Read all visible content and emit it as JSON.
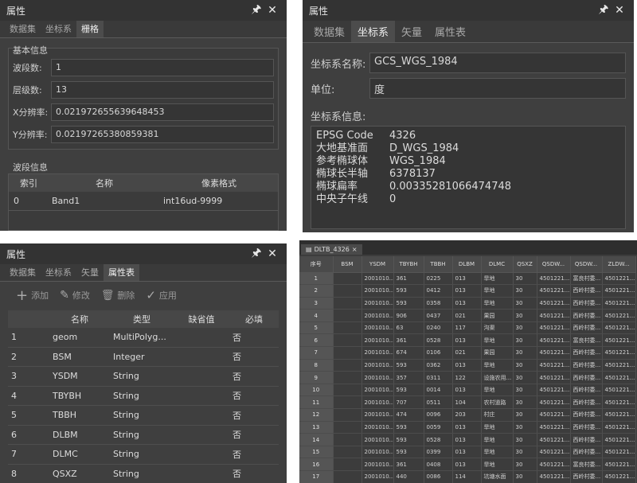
{
  "p1": {
    "title": "属性",
    "tabs": [
      "数据集",
      "坐标系",
      "栅格"
    ],
    "active_tab": 2,
    "basic_section": "基本信息",
    "fields": [
      {
        "label": "波段数:",
        "value": "1"
      },
      {
        "label": "层级数:",
        "value": "13"
      },
      {
        "label": "X分辨率:",
        "value": "0.021972655639648453"
      },
      {
        "label": "Y分辨率:",
        "value": "0.02197265380859381"
      }
    ],
    "band_section": "波段信息",
    "band_headers": [
      "索引",
      "名称",
      "像素格式"
    ],
    "band_rows": [
      [
        "0",
        "Band1",
        "int16ud-9999"
      ]
    ]
  },
  "p2": {
    "title": "属性",
    "tabs": [
      "数据集",
      "坐标系",
      "矢量",
      "属性表"
    ],
    "active_tab": 1,
    "name_label": "坐标系名称:",
    "name_value": "GCS_WGS_1984",
    "unit_label": "单位:",
    "unit_value": "度",
    "info_label": "坐标系信息:",
    "info": [
      {
        "k": "EPSG Code",
        "v": "4326"
      },
      {
        "k": "大地基准面",
        "v": "D_WGS_1984"
      },
      {
        "k": "参考椭球体",
        "v": "WGS_1984"
      },
      {
        "k": "椭球长半轴",
        "v": "6378137"
      },
      {
        "k": "椭球扁率",
        "v": "0.00335281066474748"
      },
      {
        "k": "中央子午线",
        "v": "0"
      }
    ]
  },
  "p3": {
    "title": "属性",
    "tabs": [
      "数据集",
      "坐标系",
      "矢量",
      "属性表"
    ],
    "active_tab": 3,
    "toolbar": {
      "add": "添加",
      "edit": "修改",
      "delete": "删除",
      "apply": "应用"
    },
    "headers": [
      "名称",
      "类型",
      "缺省值",
      "必填"
    ],
    "rows": [
      [
        "1",
        "geom",
        "MultiPolyg...",
        "",
        "否"
      ],
      [
        "2",
        "BSM",
        "Integer",
        "",
        "否"
      ],
      [
        "3",
        "YSDM",
        "String",
        "",
        "否"
      ],
      [
        "4",
        "TBYBH",
        "String",
        "",
        "否"
      ],
      [
        "5",
        "TBBH",
        "String",
        "",
        "否"
      ],
      [
        "6",
        "DLBM",
        "String",
        "",
        "否"
      ],
      [
        "7",
        "DLMC",
        "String",
        "",
        "否"
      ],
      [
        "8",
        "QSXZ",
        "String",
        "",
        "否"
      ]
    ]
  },
  "p4": {
    "tab": "DLTB_4326",
    "headers": [
      "序号",
      "BSM",
      "YSDM",
      "TBYBH",
      "TBBH",
      "DLBM",
      "DLMC",
      "QSXZ",
      "QSDW...",
      "QSDW...",
      "ZLDW..."
    ],
    "rows": [
      [
        "1",
        "",
        "2001010...",
        "361",
        "0225",
        "013",
        "旱地",
        "30",
        "4501221...",
        "富良村委...",
        "4501221..."
      ],
      [
        "2",
        "",
        "2001010...",
        "593",
        "0412",
        "013",
        "旱地",
        "30",
        "4501221...",
        "西岭村委...",
        "4501221..."
      ],
      [
        "3",
        "",
        "2001010...",
        "593",
        "0358",
        "013",
        "旱地",
        "30",
        "4501221...",
        "西岭村委...",
        "4501221..."
      ],
      [
        "4",
        "",
        "2001010...",
        "906",
        "0437",
        "021",
        "果园",
        "30",
        "4501221...",
        "西岭村委...",
        "4501221..."
      ],
      [
        "5",
        "",
        "2001010...",
        "63",
        "0240",
        "117",
        "沟渠",
        "30",
        "4501221...",
        "西岭村委...",
        "4501221..."
      ],
      [
        "6",
        "",
        "2001010...",
        "361",
        "0528",
        "013",
        "旱地",
        "30",
        "4501221...",
        "富良村委...",
        "4501221..."
      ],
      [
        "7",
        "",
        "2001010...",
        "674",
        "0106",
        "021",
        "果园",
        "30",
        "4501221...",
        "西岭村委...",
        "4501221..."
      ],
      [
        "8",
        "",
        "2001010...",
        "593",
        "0362",
        "013",
        "旱地",
        "30",
        "4501221...",
        "西岭村委...",
        "4501221..."
      ],
      [
        "9",
        "",
        "2001010...",
        "357",
        "0311",
        "122",
        "设施农用...",
        "30",
        "4501221...",
        "西岭村委...",
        "4501221..."
      ],
      [
        "10",
        "",
        "2001010...",
        "593",
        "0014",
        "013",
        "旱地",
        "30",
        "4501221...",
        "西岭村委...",
        "4501221..."
      ],
      [
        "11",
        "",
        "2001010...",
        "707",
        "0511",
        "104",
        "农村道路",
        "30",
        "4501221...",
        "西岭村委...",
        "4501221..."
      ],
      [
        "12",
        "",
        "2001010...",
        "474",
        "0096",
        "203",
        "村庄",
        "30",
        "4501221...",
        "西岭村委...",
        "4501221..."
      ],
      [
        "13",
        "",
        "2001010...",
        "593",
        "0059",
        "013",
        "旱地",
        "30",
        "4501221...",
        "西岭村委...",
        "4501221..."
      ],
      [
        "14",
        "",
        "2001010...",
        "593",
        "0528",
        "013",
        "旱地",
        "30",
        "4501221...",
        "西岭村委...",
        "4501221..."
      ],
      [
        "15",
        "",
        "2001010...",
        "593",
        "0399",
        "013",
        "旱地",
        "30",
        "4501221...",
        "西岭村委...",
        "4501221..."
      ],
      [
        "16",
        "",
        "2001010...",
        "361",
        "0408",
        "013",
        "旱地",
        "30",
        "4501221...",
        "富良村委...",
        "4501221..."
      ],
      [
        "17",
        "",
        "2001010...",
        "440",
        "0086",
        "114",
        "坑塘水面",
        "30",
        "4501221...",
        "西岭村委...",
        "4501221..."
      ]
    ]
  }
}
